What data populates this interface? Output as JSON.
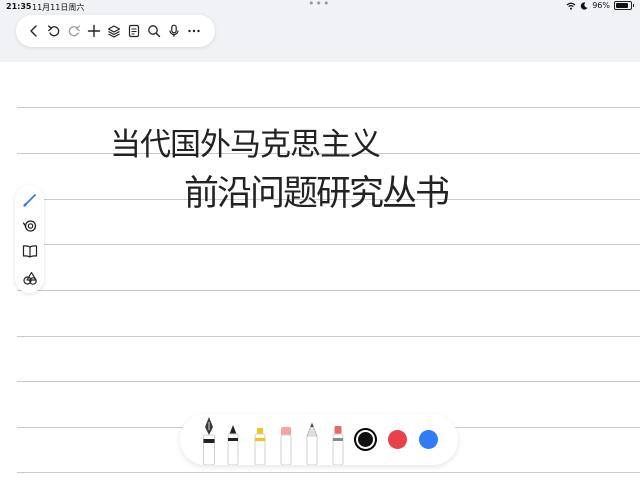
{
  "status_bar": {
    "time": "21:35",
    "date": "11月11日周六",
    "battery_percent": "96%",
    "battery_level": 0.96,
    "icons": [
      "wifi-icon",
      "moon-icon",
      "battery-icon"
    ]
  },
  "toolbar": {
    "buttons": [
      "back-icon",
      "undo-icon",
      "redo-icon",
      "add-icon",
      "layers-icon",
      "page-icon",
      "search-icon",
      "microphone-icon",
      "more-icon"
    ]
  },
  "note": {
    "lines": [
      "当代国外马克思主义",
      "前沿问题研究丛书"
    ]
  },
  "left_tools": [
    "pen-icon",
    "lasso-icon",
    "book-icon",
    "shapes-icon"
  ],
  "palette": {
    "tools": [
      "fountain-pen",
      "ballpoint-pen",
      "highlighter",
      "eraser",
      "pencil",
      "marker"
    ],
    "colors": [
      {
        "name": "black",
        "hex": "#111111",
        "selected": true
      },
      {
        "name": "red",
        "hex": "#e8414b",
        "selected": false
      },
      {
        "name": "blue",
        "hex": "#2f7cf6",
        "selected": false
      }
    ]
  }
}
